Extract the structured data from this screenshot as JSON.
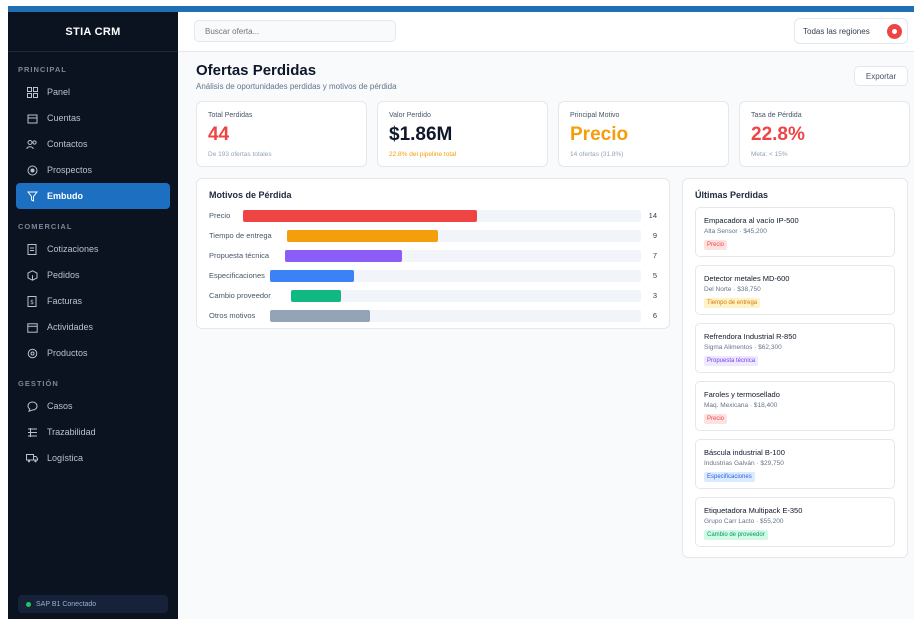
{
  "brand": "STIA CRM",
  "sidebar": {
    "sections": [
      {
        "label": "PRINCIPAL",
        "items": [
          {
            "label": "Panel",
            "icon": "grid-icon"
          },
          {
            "label": "Cuentas",
            "icon": "building-icon"
          },
          {
            "label": "Contactos",
            "icon": "users-icon"
          },
          {
            "label": "Prospectos",
            "icon": "target-icon"
          },
          {
            "label": "Embudo",
            "icon": "funnel-icon",
            "active": true
          }
        ]
      },
      {
        "label": "COMERCIAL",
        "items": [
          {
            "label": "Cotizaciones",
            "icon": "document-icon"
          },
          {
            "label": "Pedidos",
            "icon": "box-icon"
          },
          {
            "label": "Facturas",
            "icon": "invoice-icon"
          },
          {
            "label": "Actividades",
            "icon": "calendar-icon"
          },
          {
            "label": "Productos",
            "icon": "package-icon"
          }
        ]
      },
      {
        "label": "GESTIÓN",
        "items": [
          {
            "label": "Casos",
            "icon": "chat-icon"
          },
          {
            "label": "Trazabilidad",
            "icon": "list-icon"
          },
          {
            "label": "Logística",
            "icon": "truck-icon"
          }
        ]
      }
    ],
    "footer": "SAP B1 Conectado"
  },
  "topbar": {
    "search_placeholder": "Buscar oferta...",
    "region": "Todas las regiones"
  },
  "page": {
    "title": "Ofertas Perdidas",
    "subtitle": "Análisis de oportunidades perdidas y motivos de pérdida",
    "export_label": "Exportar"
  },
  "kpis": [
    {
      "label": "Total Perdidas",
      "value": "44",
      "foot": "De 193 ofertas totales",
      "color": "#ef4444",
      "foot_color": "#94a3b8"
    },
    {
      "label": "Valor Perdido",
      "value": "$1.86M",
      "foot": "22.8% del pipeline total",
      "color": "#0f172a",
      "foot_color": "#f59e0b"
    },
    {
      "label": "Principal Motivo",
      "value": "Precio",
      "foot": "14 ofertas (31.8%)",
      "color": "#f59e0b",
      "foot_color": "#94a3b8"
    },
    {
      "label": "Tasa de Pérdida",
      "value": "22.8%",
      "foot": "Meta: < 15%",
      "color": "#ef4444",
      "foot_color": "#94a3b8"
    }
  ],
  "reasons_panel": {
    "title": "Motivos de Pérdida"
  },
  "chart_data": {
    "type": "bar",
    "orientation": "horizontal",
    "categories": [
      "Precio",
      "Tiempo de entrega",
      "Propuesta técnica",
      "Especificaciones",
      "Cambio proveedor",
      "Otros motivos"
    ],
    "values": [
      14,
      9,
      7,
      5,
      3,
      6
    ],
    "colors": [
      "#ef4444",
      "#f59e0b",
      "#8b5cf6",
      "#3b82f6",
      "#10b981",
      "#94a3b8"
    ],
    "xlim": [
      0,
      14
    ]
  },
  "recent_panel": {
    "title": "Últimas Perdidas",
    "items": [
      {
        "name": "Empacadora al vacío IP-500",
        "meta": "Alta Sensor · $45,200",
        "tag": "Precio",
        "tag_color": "#ef4444",
        "tag_bg": "#fee2e2"
      },
      {
        "name": "Detector metales MD-600",
        "meta": "Del Norte · $38,750",
        "tag": "Tiempo de entrega",
        "tag_color": "#d97706",
        "tag_bg": "#fef3c7"
      },
      {
        "name": "Refrendora Industrial R-850",
        "meta": "Sigma Alimentos · $62,300",
        "tag": "Propuesta técnica",
        "tag_color": "#7c3aed",
        "tag_bg": "#ede9fe"
      },
      {
        "name": "Faroles y termosellado",
        "meta": "Maq. Mexicana · $18,400",
        "tag": "Precio",
        "tag_color": "#ef4444",
        "tag_bg": "#fee2e2"
      },
      {
        "name": "Báscula industrial B-100",
        "meta": "Industrias Galván · $29,750",
        "tag": "Especificaciones",
        "tag_color": "#2563eb",
        "tag_bg": "#dbeafe"
      },
      {
        "name": "Etiquetadora Multipack E-350",
        "meta": "Grupo Carr Lacto · $55,200",
        "tag": "Cambio de proveedor",
        "tag_color": "#059669",
        "tag_bg": "#d1fae5"
      }
    ]
  }
}
